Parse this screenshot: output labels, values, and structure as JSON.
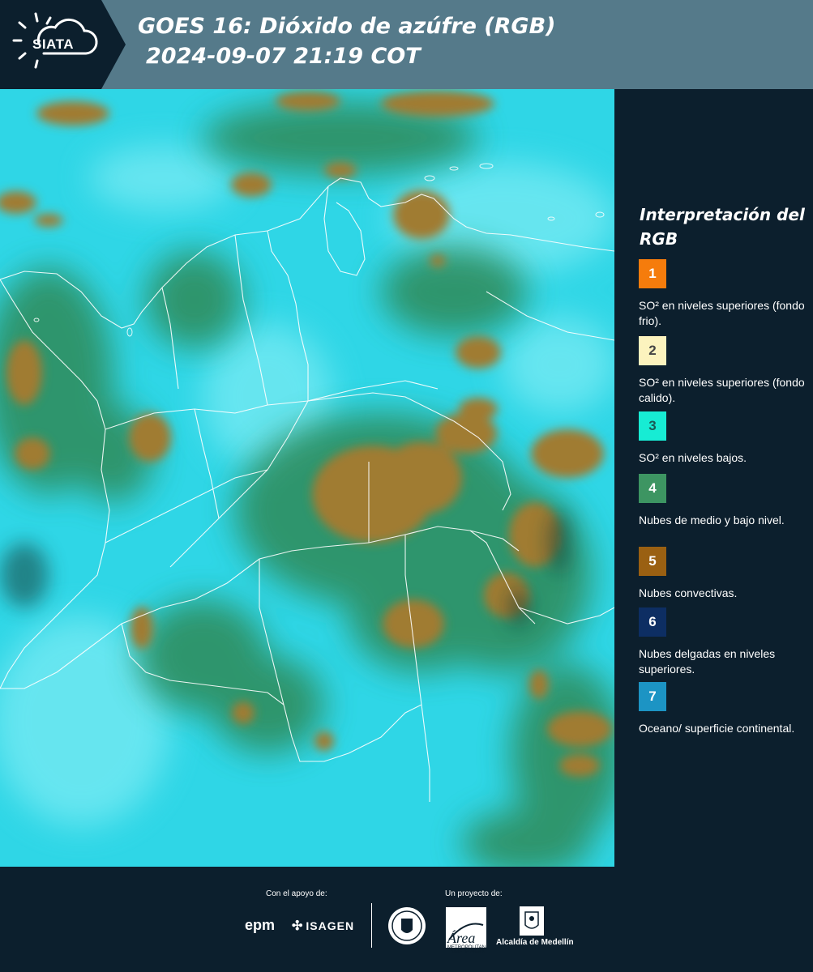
{
  "header": {
    "logo_text": "SIATA",
    "title_line1": "GOES 16: Dióxido de azúfre (RGB)",
    "title_line2": "2024-09-07 21:19 COT"
  },
  "legend": {
    "title": "Interpretación del RGB",
    "items": [
      {
        "number": "1",
        "color": "#f57c0c",
        "label": "SO² en niveles superiores (fondo frio)."
      },
      {
        "number": "2",
        "color": "#fcf3be",
        "label": "SO² en niveles superiores (fondo calido)."
      },
      {
        "number": "3",
        "color": "#17ecd4",
        "label": "SO² en niveles bajos."
      },
      {
        "number": "4",
        "color": "#3d9562",
        "label": "Nubes de medio y bajo nivel."
      },
      {
        "number": "5",
        "color": "#9a6012",
        "label": "Nubes convectivas."
      },
      {
        "number": "6",
        "color": "#0d2e63",
        "label": "Nubes delgadas en niveles superiores."
      },
      {
        "number": "7",
        "color": "#1c94c4",
        "label": "Oceano/ superficie continental."
      }
    ]
  },
  "footer": {
    "support_label": "Con el apoyo de:",
    "project_label": "Un proyecto de:",
    "sponsor_epm": "epm",
    "sponsor_isagen": "ISAGEN",
    "area_name": "Área",
    "area_sub": "METROPOLITANA Valle de Aburrá",
    "alcaldia_name": "Alcaldía de Medellín"
  },
  "colors": {
    "background": "#0c1f2d",
    "header_band": "#557a8a",
    "map_base": "#2ad4e2",
    "cloud_green": "#3b8f58",
    "cloud_brown": "#9a7a30"
  }
}
